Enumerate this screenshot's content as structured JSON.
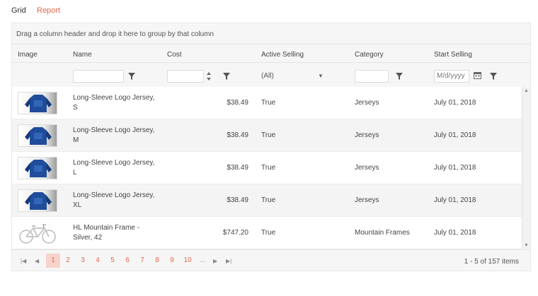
{
  "tabs": {
    "grid": "Grid",
    "report": "Report"
  },
  "grid": {
    "group_hint": "Drag a column header and drop it here to group by that column",
    "columns": [
      "Image",
      "Name",
      "Cost",
      "Active Selling",
      "Category",
      "Start Selling"
    ],
    "filters": {
      "active_selected": "(All)",
      "date_placeholder": "M/d/yyyy"
    },
    "rows": [
      {
        "image_icon": "jersey-image",
        "name_line1": "Long-Sleeve Logo Jersey,",
        "name_line2": "S",
        "cost": "$38.49",
        "active": "True",
        "category": "Jerseys",
        "start": "July 01, 2018"
      },
      {
        "image_icon": "jersey-image",
        "name_line1": "Long-Sleeve Logo Jersey,",
        "name_line2": "M",
        "cost": "$38.49",
        "active": "True",
        "category": "Jerseys",
        "start": "July 01, 2018"
      },
      {
        "image_icon": "jersey-image",
        "name_line1": "Long-Sleeve Logo Jersey,",
        "name_line2": "L",
        "cost": "$38.49",
        "active": "True",
        "category": "Jerseys",
        "start": "July 01, 2018"
      },
      {
        "image_icon": "jersey-image",
        "name_line1": "Long-Sleeve Logo Jersey,",
        "name_line2": "XL",
        "cost": "$38.49",
        "active": "True",
        "category": "Jerseys",
        "start": "July 01, 2018"
      },
      {
        "image_icon": "bike-frame-image",
        "name_line1": "HL Mountain Frame -",
        "name_line2": "Silver, 42",
        "cost": "$747.20",
        "active": "True",
        "category": "Mountain Frames",
        "start": "July 01, 2018"
      }
    ],
    "pager": {
      "pages": [
        "1",
        "2",
        "3",
        "4",
        "5",
        "6",
        "7",
        "8",
        "9",
        "10",
        "..."
      ],
      "current_page": "1",
      "info": "1 - 5 of 157 items"
    }
  },
  "colors": {
    "accent": "#e4684c",
    "active_page_bg": "#f7d3ca",
    "jersey_blue": "#1f4d9c"
  }
}
